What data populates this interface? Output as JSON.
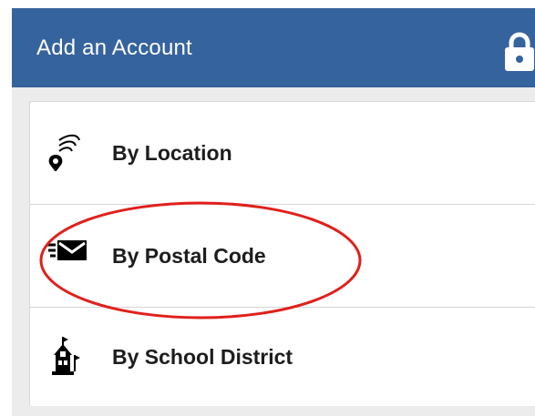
{
  "header": {
    "title": "Add an Account",
    "icon": "lock-icon",
    "background_color": "#35639d"
  },
  "menu": {
    "items": [
      {
        "label": "By Location",
        "icon": "location-signal-icon"
      },
      {
        "label": "By Postal Code",
        "icon": "envelope-icon"
      },
      {
        "label": "By School District",
        "icon": "schoolhouse-icon"
      }
    ]
  },
  "annotation": {
    "shape": "ellipse",
    "color": "#e0201b",
    "target": "By Postal Code"
  }
}
